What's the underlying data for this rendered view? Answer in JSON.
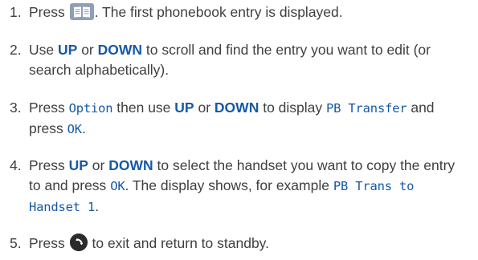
{
  "steps": [
    {
      "number": "1.",
      "press": "Press",
      "rest": ". The first phonebook entry is displayed.",
      "icon": "phonebook-icon"
    },
    {
      "number": "2.",
      "use": "Use",
      "up": "UP",
      "or": "or",
      "down": "DOWN",
      "rest": "to scroll and find the entry you want to edit (or search alphabetically)."
    },
    {
      "number": "3.",
      "press": "Press",
      "option": "Option",
      "then_use": "then use",
      "up": "UP",
      "or": "or",
      "down": "DOWN",
      "to_display": "to display",
      "pb_transfer": "PB Transfer",
      "and_press": "and press",
      "ok": "OK",
      "end": "."
    },
    {
      "number": "4.",
      "press": "Press",
      "up": "UP",
      "or": "or",
      "down": "DOWN",
      "rest": "to select the handset you want to copy the entry to and press",
      "ok": "OK",
      "display_shows": ". The display shows, for example",
      "pb_trans": "PB Trans to Handset 1",
      "end": "."
    },
    {
      "number": "5.",
      "press": "Press",
      "rest": "to exit and return to standby.",
      "icon": "end-call-icon"
    }
  ],
  "colors": {
    "text": "#3f3f3f",
    "accent": "#1559a6"
  }
}
